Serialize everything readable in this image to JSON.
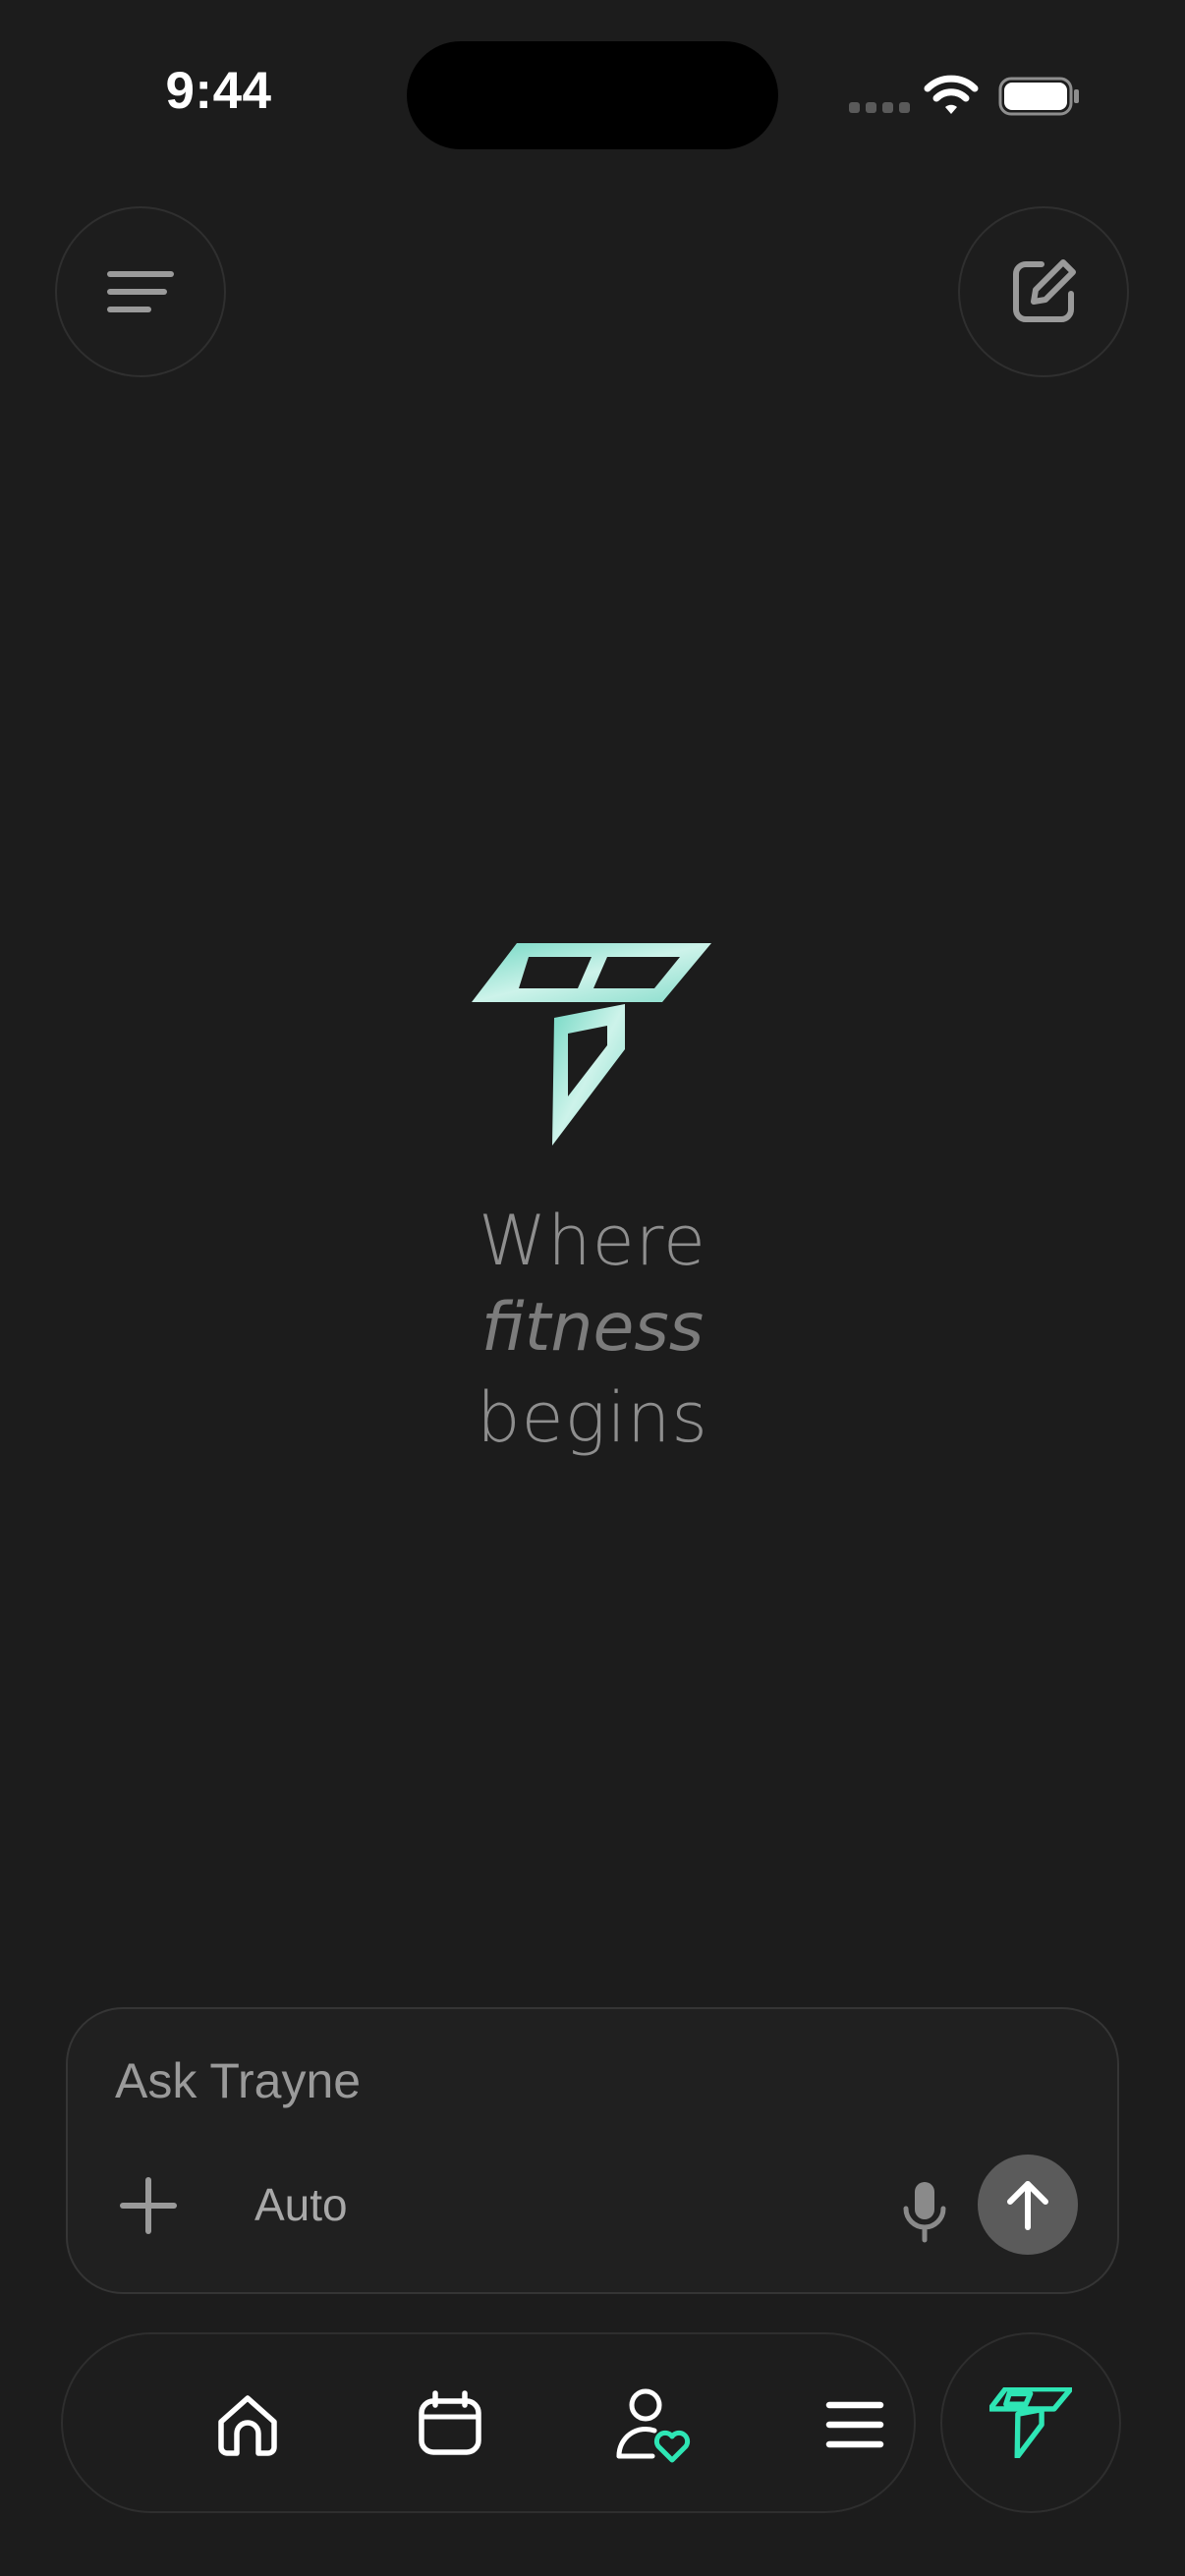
{
  "status_bar": {
    "time": "9:44",
    "icons": [
      "cellular-signal-icon",
      "wifi-icon",
      "battery-icon"
    ]
  },
  "header": {
    "left_icon": "menu-icon",
    "right_icon": "compose-icon"
  },
  "hero": {
    "logo_icon": "trayne-logo",
    "line1": "Where",
    "line2": "fitness",
    "line3": "begins"
  },
  "composer": {
    "placeholder": "Ask Trayne",
    "value": "",
    "attach_icon": "plus-icon",
    "mode": "Auto",
    "mic_icon": "microphone-icon",
    "send_icon": "arrow-up-icon"
  },
  "tab_bar": {
    "tabs": [
      {
        "icon": "home-icon"
      },
      {
        "icon": "calendar-icon"
      },
      {
        "icon": "profile-heart-icon"
      },
      {
        "icon": "menu-lines-icon"
      }
    ],
    "assistant_icon": "trayne-logo"
  },
  "colors": {
    "background": "#1c1c1c",
    "accent": "#2ee6b5",
    "logo_gradient_start": "#6fd3c0",
    "logo_gradient_end": "#d6f5ee",
    "muted_text": "#8e8e8e",
    "send_button": "#5b5b5b"
  }
}
